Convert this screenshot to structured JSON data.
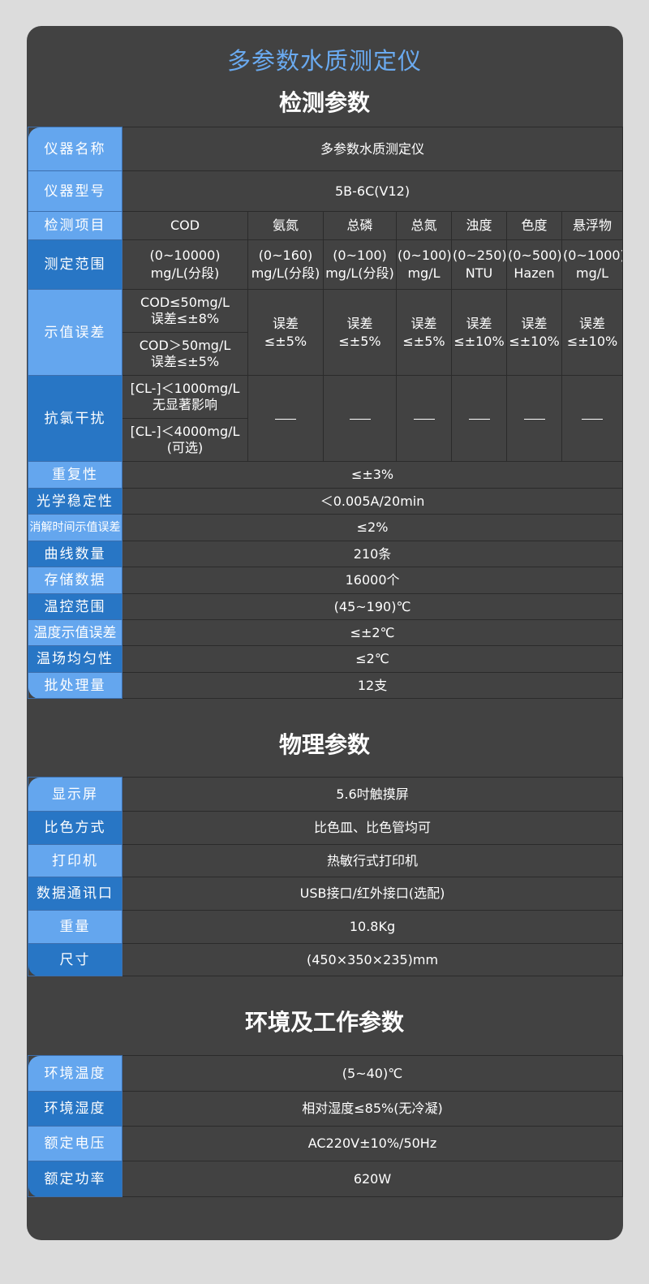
{
  "main_title": "多参数水质测定仪",
  "sections": {
    "detection": "检测参数",
    "physical": "物理参数",
    "environment": "环境及工作参数"
  },
  "detection": {
    "name": {
      "label": "仪器名称",
      "value": "多参数水质测定仪"
    },
    "model": {
      "label": "仪器型号",
      "value": "5B-6C(V12)"
    },
    "items": {
      "label": "检测项目",
      "values": [
        "COD",
        "氨氮",
        "总磷",
        "总氮",
        "浊度",
        "色度",
        "悬浮物"
      ]
    },
    "range": {
      "label": "测定范围",
      "values": [
        [
          "(0~10000)",
          "mg/L(分段)"
        ],
        [
          "(0~160)",
          "mg/L(分段)"
        ],
        [
          "(0~100)",
          "mg/L(分段)"
        ],
        [
          "(0~100)",
          "mg/L"
        ],
        [
          "(0~250)",
          "NTU"
        ],
        [
          "(0~500)",
          "Hazen"
        ],
        [
          "(0~1000)",
          "mg/L"
        ]
      ]
    },
    "error": {
      "label": "示值误差",
      "cod": [
        [
          "COD≤50mg/L",
          "误差≤±8%"
        ],
        [
          "COD＞50mg/L",
          "误差≤±5%"
        ]
      ],
      "values": [
        [
          "误差",
          "≤±5%"
        ],
        [
          "误差",
          "≤±5%"
        ],
        [
          "误差",
          "≤±5%"
        ],
        [
          "误差",
          "≤±10%"
        ],
        [
          "误差",
          "≤±10%"
        ],
        [
          "误差",
          "≤±10%"
        ]
      ]
    },
    "chlorine": {
      "label": "抗氯干扰",
      "cod": [
        [
          "[CL-]＜1000mg/L",
          "无显著影响"
        ],
        [
          "[CL-]＜4000mg/L",
          "(可选)"
        ]
      ]
    },
    "rows": [
      {
        "label": "重复性",
        "value": "≤±3%"
      },
      {
        "label": "光学稳定性",
        "value": "＜0.005A/20min"
      },
      {
        "label": "消解时间示值误差",
        "value": "≤2%"
      },
      {
        "label": "曲线数量",
        "value": "210条"
      },
      {
        "label": "存储数据",
        "value": "16000个"
      },
      {
        "label": "温控范围",
        "value": "(45~190)℃"
      },
      {
        "label": "温度示值误差",
        "value": "≤±2℃"
      },
      {
        "label": "温场均匀性",
        "value": "≤2℃"
      },
      {
        "label": "批处理量",
        "value": "12支"
      }
    ]
  },
  "physical": [
    {
      "label": "显示屏",
      "value": "5.6吋触摸屏"
    },
    {
      "label": "比色方式",
      "value": "比色皿、比色管均可"
    },
    {
      "label": "打印机",
      "value": "热敏行式打印机"
    },
    {
      "label": "数据通讯口",
      "value": "USB接口/红外接口(选配)"
    },
    {
      "label": "重量",
      "value": "10.8Kg"
    },
    {
      "label": "尺寸",
      "value": "(450×350×235)mm"
    }
  ],
  "environment": [
    {
      "label": "环境温度",
      "value": "(5~40)℃"
    },
    {
      "label": "环境湿度",
      "value": "相对湿度≤85%(无冷凝)"
    },
    {
      "label": "额定电压",
      "value": "AC220V±10%/50Hz"
    },
    {
      "label": "额定功率",
      "value": "620W"
    }
  ],
  "colors": {
    "label_light": "#64a6ee",
    "label_dark": "#2876c5",
    "title_blue": "#6aaaf0",
    "panel": "#424242",
    "page_bg": "#dcdcdc"
  }
}
